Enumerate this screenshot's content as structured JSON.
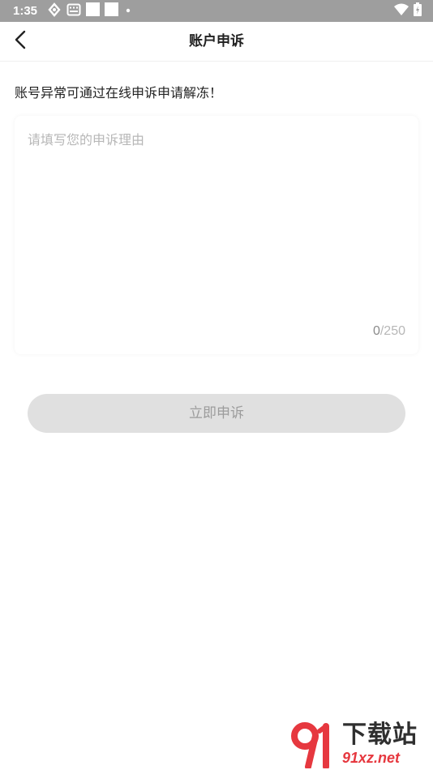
{
  "status_bar": {
    "time": "1:35",
    "left_icons": [
      "sync-icon",
      "keyboard-icon",
      "notification-square-icon",
      "notification-square-icon",
      "dot-icon"
    ],
    "right_icons": [
      "wifi-icon",
      "battery-icon"
    ]
  },
  "header": {
    "title": "账户申诉",
    "back_icon": "chevron-left-icon"
  },
  "notice": "账号异常可通过在线申诉申请解冻！",
  "form": {
    "placeholder": "请填写您的申诉理由",
    "value": "",
    "counter_current": "0",
    "counter_max": "/250"
  },
  "submit_label": "立即申诉",
  "colors": {
    "status_bar": "#9e9e9e",
    "button_bg": "#e0e0e0",
    "button_text": "#9c9c9c",
    "placeholder": "#b7b7b7",
    "watermark_red": "#e6383f"
  },
  "watermark": {
    "logo_text": "91",
    "title": "下载站",
    "url": "91xz.net"
  }
}
